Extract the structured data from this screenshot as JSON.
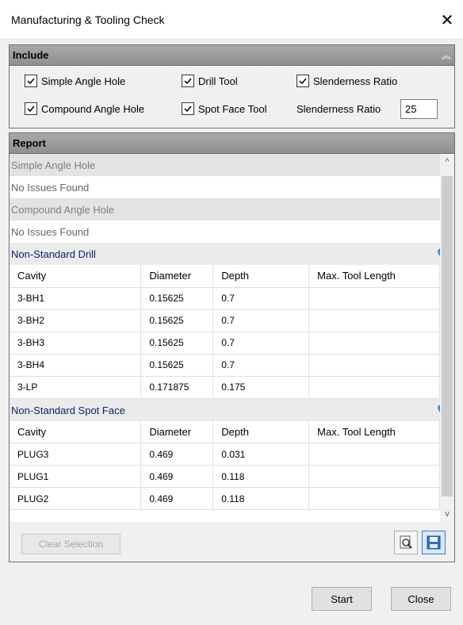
{
  "window": {
    "title": "Manufacturing & Tooling Check",
    "close_glyph": "✕"
  },
  "include": {
    "header": "Include",
    "collapse_glyph": "︽",
    "options": [
      {
        "label": "Simple Angle Hole",
        "checked": true
      },
      {
        "label": "Drill Tool",
        "checked": true
      },
      {
        "label": "Slenderness Ratio",
        "checked": true
      },
      {
        "label": "Compound Angle Hole",
        "checked": true
      },
      {
        "label": "Spot Face Tool",
        "checked": true
      }
    ],
    "ratio_label": "Slenderness Ratio",
    "ratio_value": "25"
  },
  "report": {
    "header": "Report",
    "simple_angle": {
      "title": "Simple Angle Hole",
      "message": "No Issues Found"
    },
    "compound_angle": {
      "title": "Compound Angle Hole",
      "message": "No Issues Found"
    },
    "drill": {
      "title": "Non-Standard Drill",
      "columns": [
        "Cavity",
        "Diameter",
        "Depth",
        "Max. Tool Length"
      ],
      "rows": [
        [
          "3-BH1",
          "0.15625",
          "0.7",
          ""
        ],
        [
          "3-BH2",
          "0.15625",
          "0.7",
          ""
        ],
        [
          "3-BH3",
          "0.15625",
          "0.7",
          ""
        ],
        [
          "3-BH4",
          "0.15625",
          "0.7",
          ""
        ],
        [
          "3-LP",
          "0.171875",
          "0.175",
          ""
        ]
      ]
    },
    "spot_face": {
      "title": "Non-Standard Spot Face",
      "columns": [
        "Cavity",
        "Diameter",
        "Depth",
        "Max. Tool Length"
      ],
      "rows": [
        [
          "PLUG3",
          "0.469",
          "0.031",
          ""
        ],
        [
          "PLUG1",
          "0.469",
          "0.118",
          ""
        ],
        [
          "PLUG2",
          "0.469",
          "0.118",
          ""
        ]
      ]
    },
    "scroll_up_glyph": "^",
    "scroll_down_glyph": "v",
    "clear_selection": "Clear Selection"
  },
  "buttons": {
    "start": "Start",
    "close": "Close"
  },
  "colors": {
    "group_title_blue": "#0a246a",
    "bulb_blue": "#3b8de6",
    "header_gray": "#9a9a9a"
  }
}
